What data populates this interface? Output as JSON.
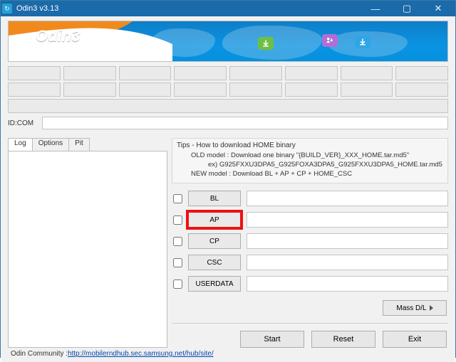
{
  "window": {
    "title": "Odin3 v3.13"
  },
  "banner": {
    "title": "Odin3"
  },
  "idcom": {
    "label": "ID:COM",
    "value": ""
  },
  "tabs": {
    "log": "Log",
    "options": "Options",
    "pit": "Pit"
  },
  "tips": {
    "heading": "Tips - How to download HOME binary",
    "line1": "OLD model : Download one binary   \"{BUILD_VER}_XXX_HOME.tar.md5\"",
    "line2": "ex) G925FXXU3DPA5_G925FOXA3DPA5_G925FXXU3DPA5_HOME.tar.md5",
    "line3": "NEW model : Download BL + AP + CP + HOME_CSC"
  },
  "slots": [
    {
      "label": "BL",
      "checked": false,
      "path": "",
      "highlight": false
    },
    {
      "label": "AP",
      "checked": false,
      "path": "",
      "highlight": true
    },
    {
      "label": "CP",
      "checked": false,
      "path": "",
      "highlight": false
    },
    {
      "label": "CSC",
      "checked": false,
      "path": "",
      "highlight": false
    },
    {
      "label": "USERDATA",
      "checked": false,
      "path": "",
      "highlight": false
    }
  ],
  "buttons": {
    "mass": "Mass D/L",
    "start": "Start",
    "reset": "Reset",
    "exit": "Exit"
  },
  "footer": {
    "prefix": "Odin Community : ",
    "link": "http://mobilerndhub.sec.samsung.net/hub/site/"
  }
}
